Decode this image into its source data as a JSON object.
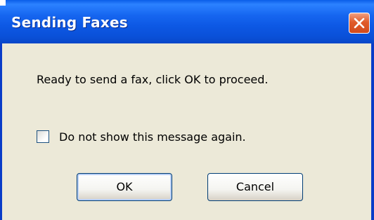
{
  "window": {
    "title": "Sending Faxes"
  },
  "body": {
    "message": "Ready to send a fax, click OK to proceed.",
    "checkbox_label": "Do not show this message again.",
    "checkbox_checked": false
  },
  "buttons": {
    "ok_label": "OK",
    "cancel_label": "Cancel"
  },
  "icons": {
    "close": "close-icon"
  },
  "colors": {
    "titlebar": "#0a50d8",
    "close_button": "#e05a2a",
    "client_background": "#ece9d8"
  }
}
